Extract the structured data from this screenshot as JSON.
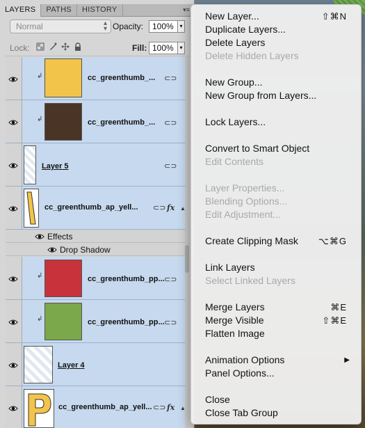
{
  "tabs": [
    {
      "label": "LAYERS",
      "active": true
    },
    {
      "label": "PATHS",
      "active": false
    },
    {
      "label": "HISTORY",
      "active": false
    }
  ],
  "panel_menu_icon": "panel-menu-icon",
  "blend_mode": {
    "value": "Normal"
  },
  "opacity": {
    "label": "Opacity:",
    "value": "100%"
  },
  "lock": {
    "label": "Lock:",
    "icons": [
      "lock-transparent-icon",
      "lock-pixels-icon",
      "lock-position-icon",
      "lock-all-icon"
    ]
  },
  "fill": {
    "label": "Fill:",
    "value": "100%"
  },
  "layers": [
    {
      "name": "cc_greenthumb_...",
      "clipped": true,
      "thumb": "#f2c449",
      "link": true
    },
    {
      "name": "cc_greenthumb_...",
      "clipped": true,
      "thumb": "#4a3426",
      "link": true
    },
    {
      "name": "Layer 5",
      "clipped": false,
      "thumb": "#ffffff",
      "link": true
    },
    {
      "name": "cc_greenthumb_ap_yell...",
      "clipped": false,
      "thumb": "#f2c449",
      "link": true,
      "fx": true
    },
    {
      "name": "cc_greenthumb_pp...",
      "clipped": true,
      "thumb": "#c8323a",
      "link": true
    },
    {
      "name": "cc_greenthumb_pp...",
      "clipped": true,
      "thumb": "#7aa84a",
      "link": true
    },
    {
      "name": "Layer 4",
      "clipped": false,
      "thumb": "#ffffff",
      "link": false
    },
    {
      "name": "cc_greenthumb_ap_yell...",
      "clipped": false,
      "thumb": "#f2c449",
      "link": true,
      "fx": true
    }
  ],
  "effects": {
    "label": "Effects",
    "drop_shadow": "Drop Shadow"
  },
  "menu": {
    "new_layer": {
      "label": "New Layer...",
      "shortcut": "⇧⌘N"
    },
    "duplicate_layers": {
      "label": "Duplicate Layers..."
    },
    "delete_layers": {
      "label": "Delete Layers"
    },
    "delete_hidden_layers": {
      "label": "Delete Hidden Layers"
    },
    "new_group": {
      "label": "New Group..."
    },
    "new_group_from_layers": {
      "label": "New Group from Layers..."
    },
    "lock_layers": {
      "label": "Lock Layers..."
    },
    "convert_smart_object": {
      "label": "Convert to Smart Object"
    },
    "edit_contents": {
      "label": "Edit Contents"
    },
    "layer_properties": {
      "label": "Layer Properties..."
    },
    "blending_options": {
      "label": "Blending Options..."
    },
    "edit_adjustment": {
      "label": "Edit Adjustment..."
    },
    "create_clipping_mask": {
      "label": "Create Clipping Mask",
      "shortcut": "⌥⌘G"
    },
    "link_layers": {
      "label": "Link Layers"
    },
    "select_linked_layers": {
      "label": "Select Linked Layers"
    },
    "merge_layers": {
      "label": "Merge Layers",
      "shortcut": "⌘E"
    },
    "merge_visible": {
      "label": "Merge Visible",
      "shortcut": "⇧⌘E"
    },
    "flatten_image": {
      "label": "Flatten Image"
    },
    "animation_options": {
      "label": "Animation Options"
    },
    "panel_options": {
      "label": "Panel Options..."
    },
    "close": {
      "label": "Close"
    },
    "close_tab_group": {
      "label": "Close Tab Group"
    }
  }
}
